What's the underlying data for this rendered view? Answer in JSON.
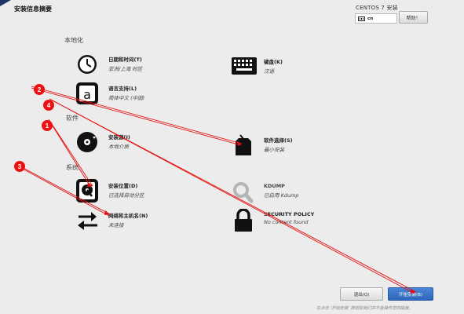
{
  "header": {
    "hub_title": "安装信息摘要",
    "install_title": "CENTOS 7 安装",
    "keyboard_layout": "cn",
    "help_label": "帮助！"
  },
  "categories": {
    "localization": "本地化",
    "software": "软件",
    "system": "系统"
  },
  "spokes": {
    "datetime": {
      "title": "日期和时间(T)",
      "status": "亚洲/上海 时区",
      "icon": "clock-icon"
    },
    "keyboard": {
      "title": "键盘(K)",
      "status": "汉语",
      "icon": "keyboard-icon"
    },
    "language": {
      "title": "语言支持(L)",
      "status": "简体中文 (中国)",
      "icon": "language-icon"
    },
    "source": {
      "title": "安装源(I)",
      "status": "本地介质",
      "icon": "disc-icon"
    },
    "software_selection": {
      "title": "软件选择(S)",
      "status": "最小安装",
      "icon": "package-icon"
    },
    "destination": {
      "title": "安装位置(D)",
      "status": "已选择自动分区",
      "icon": "harddisk-icon"
    },
    "kdump": {
      "title": "KDUMP",
      "status": "已启用 Kdump",
      "icon": "search-icon"
    },
    "network": {
      "title": "网络和主机名(N)",
      "status": "未连接",
      "icon": "network-arrows-icon"
    },
    "security": {
      "title": "SECURITY POLICY",
      "status": "No content found",
      "icon": "lock-icon"
    }
  },
  "footer": {
    "quit_label": "退出(Q)",
    "begin_label": "开始安装(B)",
    "note": "在点击 '开始安装' 按钮前我们并不会操作您的磁盘。"
  },
  "annotations": {
    "markers": [
      "1",
      "2",
      "3",
      "4"
    ],
    "color": "#e11111"
  },
  "colors": {
    "sidebar": "#21407f",
    "accent": "#2d66b8",
    "background": "#ececec"
  }
}
